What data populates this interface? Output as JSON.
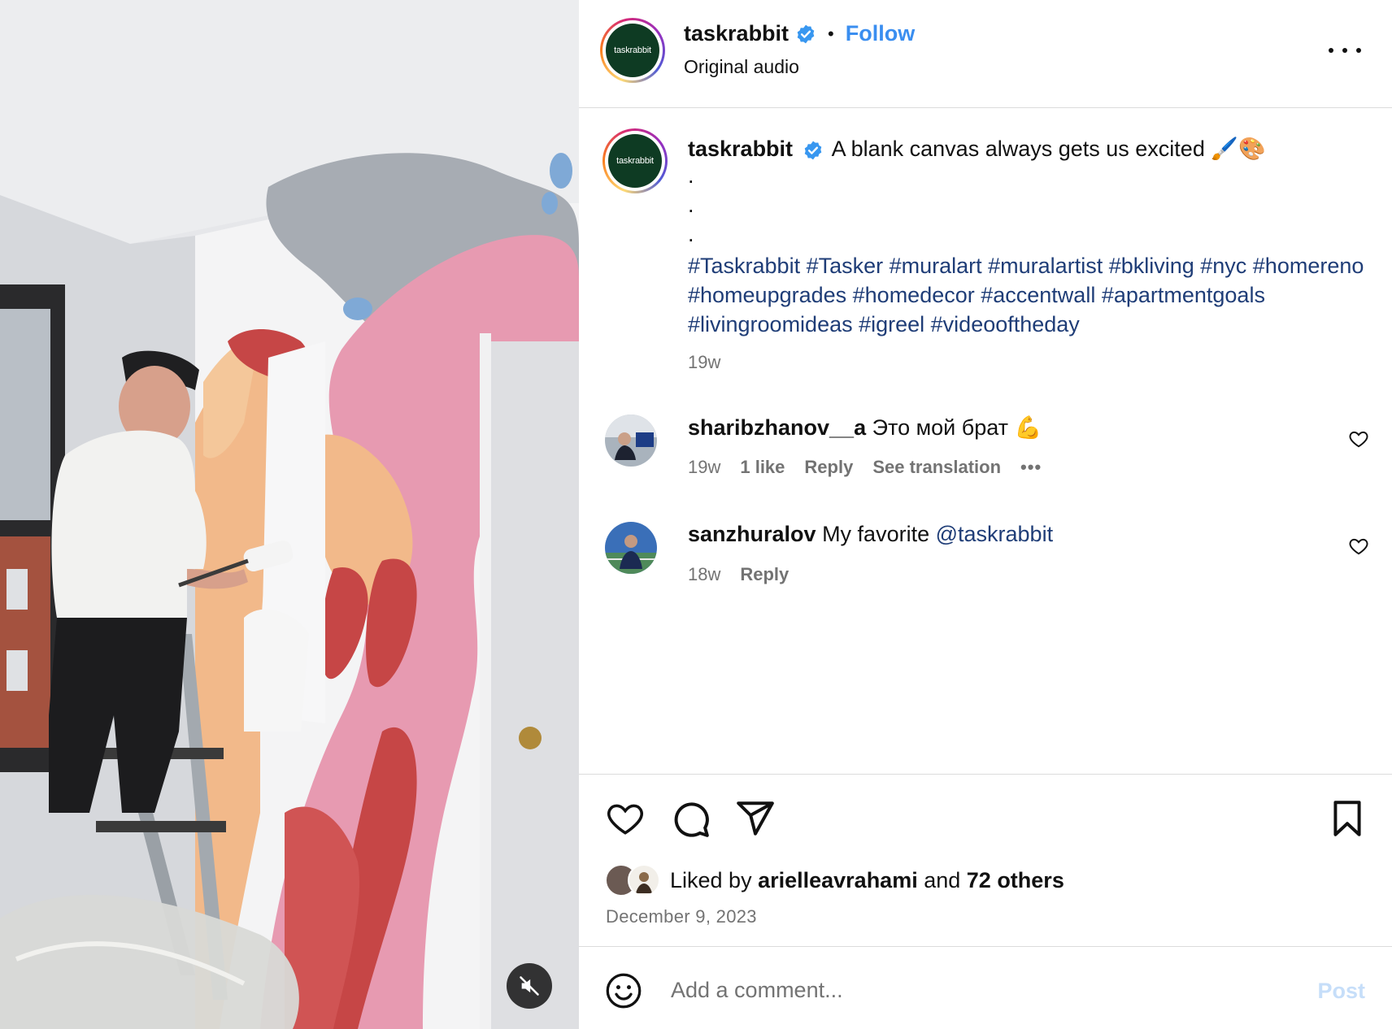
{
  "post": {
    "author": "taskrabbit",
    "avatar_text": "taskrabbit",
    "follow_label": "Follow",
    "separator": "•",
    "audio": "Original audio",
    "media_muted": true
  },
  "caption": {
    "username": "taskrabbit",
    "text": "A blank canvas always gets us excited 🖌️🎨",
    "dots": [
      ".",
      ".",
      "."
    ],
    "hashtags": "#Taskrabbit #Tasker #muralart #muralartist #bkliving #nyc #homereno #homeupgrades #homedecor #accentwall #apartmentgoals #livingroomideas #igreel #videooftheday",
    "time": "19w"
  },
  "comments": [
    {
      "username": "sharibzhanov__a",
      "text": "Это мой брат 💪",
      "time": "19w",
      "likes": "1 like",
      "reply_label": "Reply",
      "translate_label": "See translation",
      "more": "•••"
    },
    {
      "username": "sanzhuralov",
      "text_before": "My favorite ",
      "mention": "@taskrabbit",
      "time": "18w",
      "reply_label": "Reply"
    }
  ],
  "likes": {
    "prefix": "Liked by ",
    "liker": "arielleavrahami",
    "middle": " and ",
    "others": "72 others"
  },
  "date": "December 9, 2023",
  "comment_box": {
    "placeholder": "Add a comment...",
    "post_label": "Post"
  },
  "colors": {
    "follow_blue": "#3a8ef0",
    "hashtag_blue": "#1f3d77",
    "muted_text": "#737373",
    "avatar_green": "#0e3b23",
    "post_disabled": "#c6def9",
    "verified_blue": "#3897f0"
  },
  "icons": {
    "verified": "verified-badge-icon",
    "more": "more-options-icon",
    "heart": "heart-icon",
    "comment": "comment-icon",
    "share": "share-icon",
    "save": "bookmark-icon",
    "emoji": "emoji-icon",
    "mute": "muted-speaker-icon"
  }
}
